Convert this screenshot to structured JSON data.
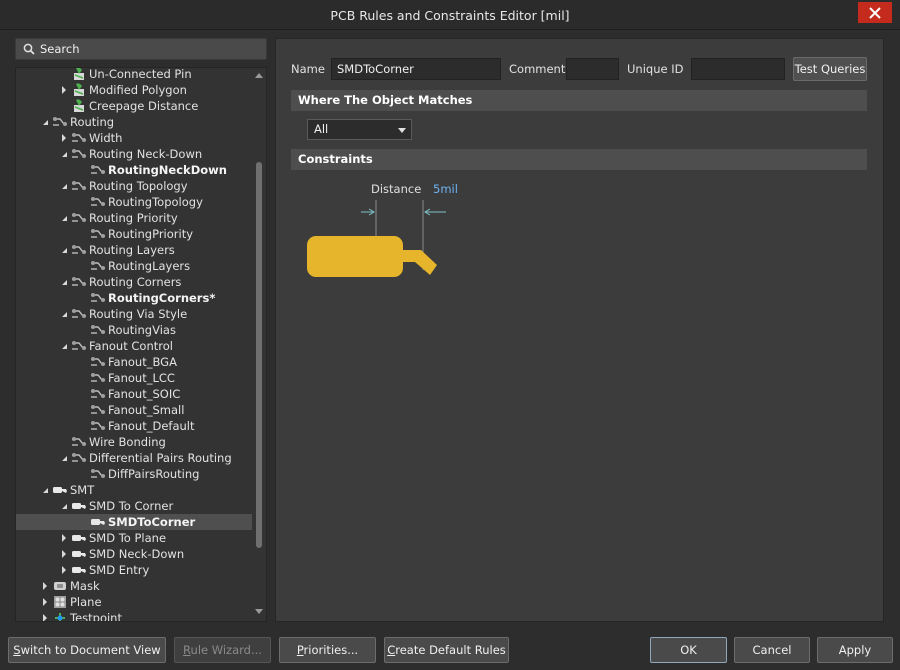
{
  "window": {
    "title": "PCB Rules and Constraints Editor [mil]"
  },
  "search": {
    "placeholder": "Search"
  },
  "tree": {
    "items": [
      {
        "label": "Un-Connected Pin",
        "level": 2,
        "icon": "rule-green-icon",
        "expander": "none",
        "bold": false
      },
      {
        "label": "Modified Polygon",
        "level": 2,
        "icon": "rule-green-icon",
        "expander": "collapsed",
        "bold": false
      },
      {
        "label": "Creepage Distance",
        "level": 2,
        "icon": "rule-green-icon",
        "expander": "none",
        "bold": false
      },
      {
        "label": "Routing",
        "level": 1,
        "icon": "routing-icon",
        "expander": "expanded",
        "bold": false
      },
      {
        "label": "Width",
        "level": 2,
        "icon": "routing-icon",
        "expander": "collapsed",
        "bold": false
      },
      {
        "label": "Routing Neck-Down",
        "level": 2,
        "icon": "routing-icon",
        "expander": "expanded",
        "bold": false
      },
      {
        "label": "RoutingNeckDown",
        "level": 3,
        "icon": "routing-icon",
        "expander": "none",
        "bold": true
      },
      {
        "label": "Routing Topology",
        "level": 2,
        "icon": "routing-icon",
        "expander": "expanded",
        "bold": false
      },
      {
        "label": "RoutingTopology",
        "level": 3,
        "icon": "routing-icon",
        "expander": "none",
        "bold": false
      },
      {
        "label": "Routing Priority",
        "level": 2,
        "icon": "routing-icon",
        "expander": "expanded",
        "bold": false
      },
      {
        "label": "RoutingPriority",
        "level": 3,
        "icon": "routing-icon",
        "expander": "none",
        "bold": false
      },
      {
        "label": "Routing Layers",
        "level": 2,
        "icon": "routing-icon",
        "expander": "expanded",
        "bold": false
      },
      {
        "label": "RoutingLayers",
        "level": 3,
        "icon": "routing-icon",
        "expander": "none",
        "bold": false
      },
      {
        "label": "Routing Corners",
        "level": 2,
        "icon": "routing-icon",
        "expander": "expanded",
        "bold": false
      },
      {
        "label": "RoutingCorners*",
        "level": 3,
        "icon": "routing-icon",
        "expander": "none",
        "bold": true
      },
      {
        "label": "Routing Via Style",
        "level": 2,
        "icon": "routing-icon",
        "expander": "expanded",
        "bold": false
      },
      {
        "label": "RoutingVias",
        "level": 3,
        "icon": "routing-icon",
        "expander": "none",
        "bold": false
      },
      {
        "label": "Fanout Control",
        "level": 2,
        "icon": "routing-icon",
        "expander": "expanded",
        "bold": false
      },
      {
        "label": "Fanout_BGA",
        "level": 3,
        "icon": "routing-icon",
        "expander": "none",
        "bold": false
      },
      {
        "label": "Fanout_LCC",
        "level": 3,
        "icon": "routing-icon",
        "expander": "none",
        "bold": false
      },
      {
        "label": "Fanout_SOIC",
        "level": 3,
        "icon": "routing-icon",
        "expander": "none",
        "bold": false
      },
      {
        "label": "Fanout_Small",
        "level": 3,
        "icon": "routing-icon",
        "expander": "none",
        "bold": false
      },
      {
        "label": "Fanout_Default",
        "level": 3,
        "icon": "routing-icon",
        "expander": "none",
        "bold": false
      },
      {
        "label": "Wire Bonding",
        "level": 2,
        "icon": "routing-icon",
        "expander": "none",
        "bold": false
      },
      {
        "label": "Differential Pairs Routing",
        "level": 2,
        "icon": "routing-icon",
        "expander": "expanded",
        "bold": false
      },
      {
        "label": "DiffPairsRouting",
        "level": 3,
        "icon": "routing-icon",
        "expander": "none",
        "bold": false
      },
      {
        "label": "SMT",
        "level": 1,
        "icon": "smt-icon",
        "expander": "expanded",
        "bold": false
      },
      {
        "label": "SMD To Corner",
        "level": 2,
        "icon": "smt-icon",
        "expander": "expanded",
        "bold": false
      },
      {
        "label": "SMDToCorner",
        "level": 3,
        "icon": "smt-icon",
        "expander": "none",
        "bold": true,
        "selected": true
      },
      {
        "label": "SMD To Plane",
        "level": 2,
        "icon": "smt-icon",
        "expander": "collapsed",
        "bold": false
      },
      {
        "label": "SMD Neck-Down",
        "level": 2,
        "icon": "smt-icon",
        "expander": "collapsed",
        "bold": false
      },
      {
        "label": "SMD Entry",
        "level": 2,
        "icon": "smt-icon",
        "expander": "collapsed",
        "bold": false
      },
      {
        "label": "Mask",
        "level": 1,
        "icon": "mask-icon",
        "expander": "collapsed",
        "bold": false
      },
      {
        "label": "Plane",
        "level": 1,
        "icon": "plane-icon",
        "expander": "collapsed",
        "bold": false
      },
      {
        "label": "Testpoint",
        "level": 1,
        "icon": "testpoint-icon",
        "expander": "collapsed",
        "bold": false
      }
    ]
  },
  "rule": {
    "name_label": "Name",
    "name_value": "SMDToCorner",
    "comment_label": "Comment",
    "comment_value": "",
    "uid_label": "Unique ID",
    "uid_value": "",
    "test_queries": "Test Queries"
  },
  "where": {
    "header": "Where The Object Matches",
    "selected": "All"
  },
  "constraints": {
    "header": "Constraints",
    "distance_label": "Distance",
    "distance_value": "5mil"
  },
  "buttons": {
    "switch_view": "Switch to Document View",
    "rule_wizard": "Rule Wizard...",
    "priorities": "Priorities...",
    "create_default": "Create Default Rules",
    "ok": "OK",
    "cancel": "Cancel",
    "apply": "Apply"
  },
  "colors": {
    "pad": "#e6b52c",
    "accent_value": "#6db3f2",
    "close": "#c42b1c"
  }
}
